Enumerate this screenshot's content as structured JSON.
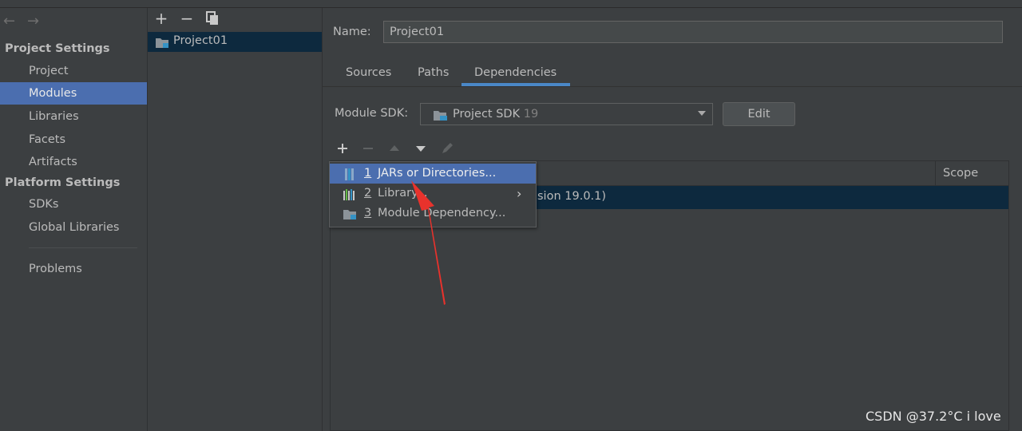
{
  "left_nav": {
    "back_arrow": "←",
    "forward_arrow": "→",
    "project_settings_heading": "Project Settings",
    "project_settings_items": [
      {
        "label": "Project",
        "selected": false
      },
      {
        "label": "Modules",
        "selected": true
      },
      {
        "label": "Libraries",
        "selected": false
      },
      {
        "label": "Facets",
        "selected": false
      },
      {
        "label": "Artifacts",
        "selected": false
      }
    ],
    "platform_settings_heading": "Platform Settings",
    "platform_settings_items": [
      {
        "label": "SDKs"
      },
      {
        "label": "Global Libraries"
      }
    ],
    "problems_label": "Problems"
  },
  "module_tree": {
    "toolbar": {
      "add": "+",
      "remove": "−"
    },
    "selected_module": "Project01"
  },
  "module_panel": {
    "name_label": "Name:",
    "name_value": "Project01",
    "tabs": [
      {
        "label": "Sources",
        "active": false
      },
      {
        "label": "Paths",
        "active": false
      },
      {
        "label": "Dependencies",
        "active": true
      }
    ],
    "module_sdk_label": "Module SDK:",
    "module_sdk_value": "Project SDK",
    "module_sdk_version": "19",
    "edit_button": "Edit",
    "deps_table": {
      "scope_header": "Scope",
      "row_text": "sion 19.0.1)"
    }
  },
  "add_menu": {
    "items": [
      {
        "number": "1",
        "label": "JARs or Directories...",
        "selected": true,
        "icon": "jar-icon"
      },
      {
        "number": "2",
        "label": "Library...",
        "selected": false,
        "icon": "library-icon",
        "submenu": "›"
      },
      {
        "number": "3",
        "label": "Module Dependency...",
        "selected": false,
        "icon": "module-icon"
      }
    ]
  },
  "watermark": "CSDN @37.2°C i love",
  "colors": {
    "background": "#3c3f41",
    "selection": "#4b6eaf",
    "tree_selection": "#0d293e",
    "tab_underline": "#4a88c7",
    "annotation_arrow": "#e8322c"
  }
}
